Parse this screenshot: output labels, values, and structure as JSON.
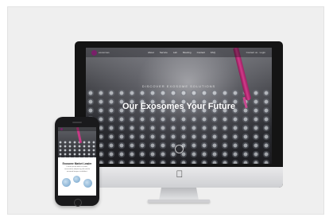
{
  "desktop": {
    "brand": "exosomes",
    "nav": [
      "About",
      "Service",
      "Lab",
      "Meeting",
      "Contact",
      "FAQ"
    ],
    "nav_right": "Contact us · Login",
    "hero_tagline": "DISCOVER EXOSOME SOLUTIONS",
    "hero_title": "Our Exosomes Your Future"
  },
  "mobile": {
    "section_title": "Exosome Market Leader",
    "section_text": "Lorem ipsum dolor sit amet, consectetur adipiscing elit sed do eiusmod tempor incididunt."
  },
  "colors": {
    "background": "#efefef",
    "accent": "#c93a86",
    "device": "#141414"
  },
  "icons": [
    "apple-icon",
    "home-button-icon",
    "menu-icon"
  ]
}
